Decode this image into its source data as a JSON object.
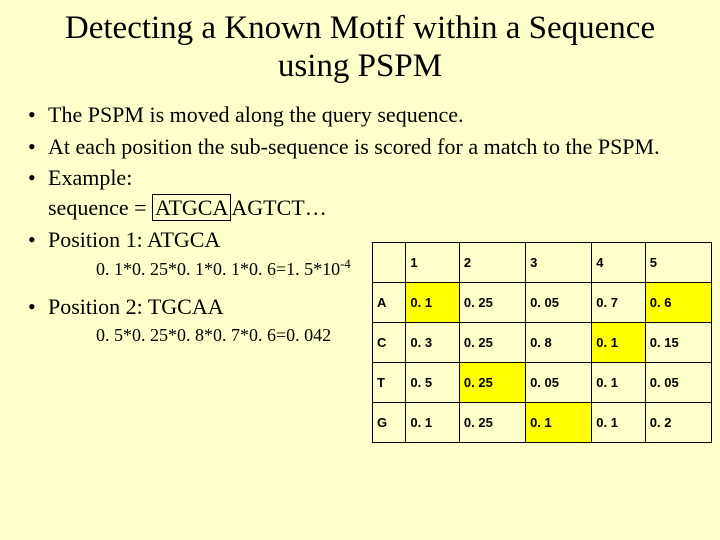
{
  "title": "Detecting a Known Motif within a Sequence using PSPM",
  "bullets": {
    "b1": "The PSPM is moved along the query sequence.",
    "b2": "At each position the sub-sequence is scored for a match to the PSPM.",
    "b3_label": "Example:",
    "b3_seq_prefix": "sequence = ",
    "b3_seq_box": "ATGCA",
    "b3_seq_suffix": "AGTCT…",
    "b4": "Position 1: ATGCA",
    "calc1_text": "0. 1*0. 25*0. 1*0. 1*0. 6=1. 5*10",
    "calc1_exp": "-4",
    "b5": "Position 2: TGCAA",
    "calc2_text": "0. 5*0. 25*0. 8*0. 7*0. 6=0. 042"
  },
  "table": {
    "cols": [
      "1",
      "2",
      "3",
      "4",
      "5"
    ],
    "rows": [
      {
        "label": "A",
        "cells": [
          {
            "v": "0. 1",
            "hl": true
          },
          {
            "v": "0. 25",
            "hl": false
          },
          {
            "v": "0. 05",
            "hl": false
          },
          {
            "v": "0. 7",
            "hl": false
          },
          {
            "v": "0. 6",
            "hl": true
          }
        ]
      },
      {
        "label": "C",
        "cells": [
          {
            "v": "0. 3",
            "hl": false
          },
          {
            "v": "0. 25",
            "hl": false
          },
          {
            "v": "0. 8",
            "hl": false
          },
          {
            "v": "0. 1",
            "hl": true
          },
          {
            "v": "0. 15",
            "hl": false
          }
        ]
      },
      {
        "label": "T",
        "cells": [
          {
            "v": "0. 5",
            "hl": false
          },
          {
            "v": "0. 25",
            "hl": true
          },
          {
            "v": "0. 05",
            "hl": false
          },
          {
            "v": "0. 1",
            "hl": false
          },
          {
            "v": "0. 05",
            "hl": false
          }
        ]
      },
      {
        "label": "G",
        "cells": [
          {
            "v": "0. 1",
            "hl": false
          },
          {
            "v": "0. 25",
            "hl": false
          },
          {
            "v": "0. 1",
            "hl": true
          },
          {
            "v": "0. 1",
            "hl": false
          },
          {
            "v": "0. 2",
            "hl": false
          }
        ]
      }
    ]
  }
}
